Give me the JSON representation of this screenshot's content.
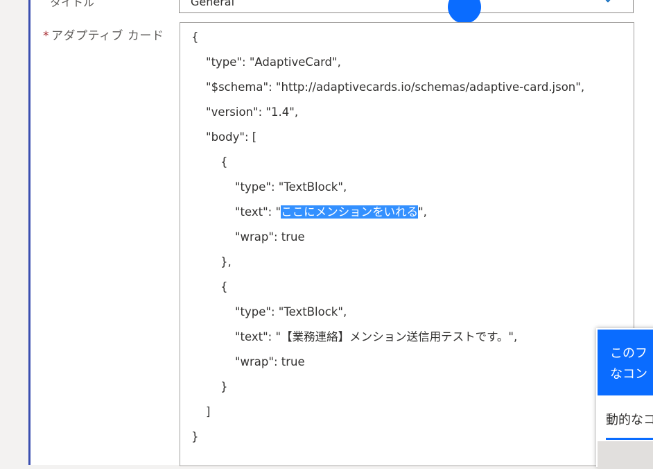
{
  "form": {
    "top_label": "タイトル",
    "top_value": "General",
    "required_mark": "*",
    "card_label": "アダプティブ カード"
  },
  "editor": {
    "lines": [
      "{",
      "    \"type\": \"AdaptiveCard\",",
      "    \"$schema\": \"http://adaptivecards.io/schemas/adaptive-card.json\",",
      "    \"version\": \"1.4\",",
      "    \"body\": [",
      "        {",
      "            \"type\": \"TextBlock\",",
      "            \"text\": \"",
      "            \"wrap\": true",
      "        },",
      "        {",
      "            \"type\": \"TextBlock\",",
      "            \"text\": \"【業務連絡】メンション送信用テストです。\",",
      "            \"wrap\": true",
      "        }",
      "    ]",
      "}"
    ],
    "selected_text": "ここにメンションをいれる",
    "after_selection": "\","
  },
  "dynamic_panel": {
    "header_line1": "このフ",
    "header_line2": "なコン",
    "tab_label": "動的なコ"
  },
  "colors": {
    "accent": "#0a6cff",
    "selection": "#3390ff",
    "required": "#a4262c",
    "card_border": "#3b4fb0"
  }
}
